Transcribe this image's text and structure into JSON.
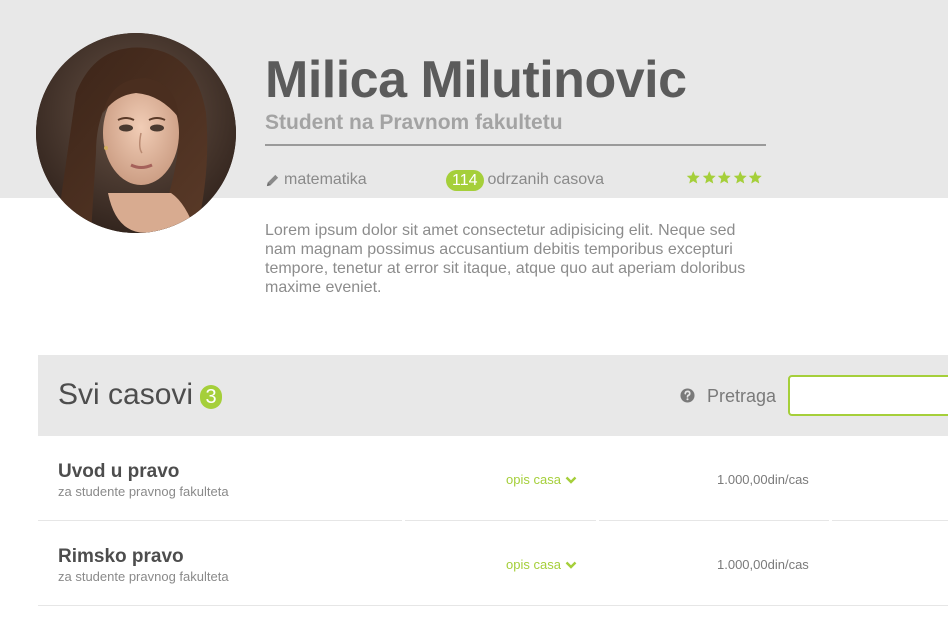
{
  "profile": {
    "name": "Milica Milutinovic",
    "subtitle": "Student na Pravnom fakultetu",
    "subject": "matematika",
    "lessons_count": "114",
    "lessons_label": "odrzanih casova",
    "rating_stars": 5,
    "bio": "Lorem ipsum dolor sit amet consectetur adipisicing elit. Neque sed nam magnam possimus accusantium debitis temporibus excepturi tempore, tenetur at error sit itaque, atque quo aut aperiam doloribus maxime eveniet."
  },
  "lessons": {
    "title": "Svi casovi",
    "count": "3",
    "search_label": "Pretraga",
    "search_value": "",
    "items": [
      {
        "title": "Uvod u pravo",
        "subtitle": "za studente pravnog fakulteta",
        "desc_label": "opis casa",
        "price": "1.000,00din/cas"
      },
      {
        "title": "Rimsko pravo",
        "subtitle": "za studente pravnog fakulteta",
        "desc_label": "opis casa",
        "price": "1.000,00din/cas"
      }
    ]
  },
  "colors": {
    "accent": "#a5cf3a",
    "band": "#e8e8e8",
    "heading": "#5b5b5b",
    "muted": "#8c8c8c"
  },
  "icons": {
    "subject": "pencil-icon",
    "rating": "star-icon",
    "search_help": "question-circle-icon",
    "expand": "chevron-down-icon"
  }
}
